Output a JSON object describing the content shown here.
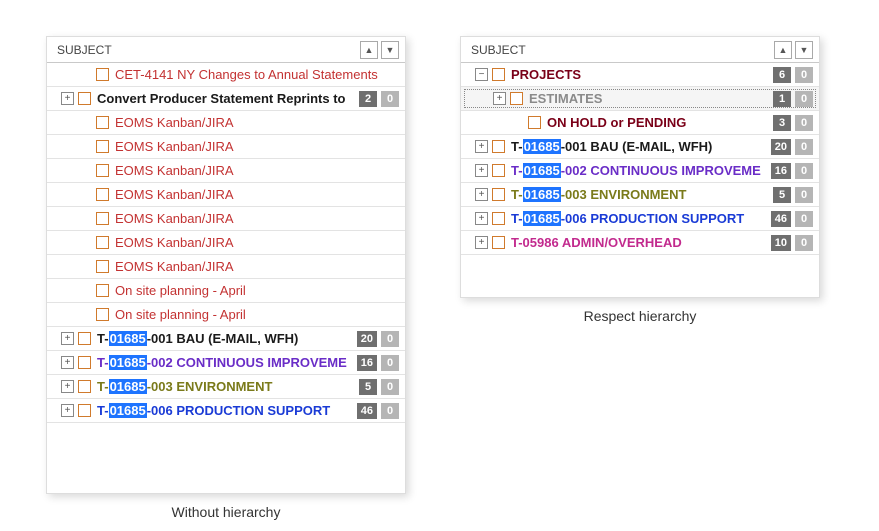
{
  "header": {
    "label": "SUBJECT"
  },
  "captions": {
    "left": "Without hierarchy",
    "right": "Respect hierarchy"
  },
  "left_rows": [
    {
      "indent": 1,
      "expander": "",
      "color": "c-red",
      "bold": false,
      "text_plain": "CET-4141  NY Changes to Annual Statements",
      "badges": []
    },
    {
      "indent": 0,
      "expander": "+",
      "color": "c-black",
      "bold": true,
      "text_plain": "Convert Producer Statement Reprints to",
      "badges": [
        2,
        0
      ]
    },
    {
      "indent": 1,
      "expander": "",
      "color": "c-red",
      "bold": false,
      "text_plain": "EOMS Kanban/JIRA",
      "badges": []
    },
    {
      "indent": 1,
      "expander": "",
      "color": "c-red",
      "bold": false,
      "text_plain": "EOMS Kanban/JIRA",
      "badges": []
    },
    {
      "indent": 1,
      "expander": "",
      "color": "c-red",
      "bold": false,
      "text_plain": "EOMS Kanban/JIRA",
      "badges": []
    },
    {
      "indent": 1,
      "expander": "",
      "color": "c-red",
      "bold": false,
      "text_plain": "EOMS Kanban/JIRA",
      "badges": []
    },
    {
      "indent": 1,
      "expander": "",
      "color": "c-red",
      "bold": false,
      "text_plain": "EOMS Kanban/JIRA",
      "badges": []
    },
    {
      "indent": 1,
      "expander": "",
      "color": "c-red",
      "bold": false,
      "text_plain": "EOMS Kanban/JIRA",
      "badges": []
    },
    {
      "indent": 1,
      "expander": "",
      "color": "c-red",
      "bold": false,
      "text_plain": "EOMS Kanban/JIRA",
      "badges": []
    },
    {
      "indent": 1,
      "expander": "",
      "color": "c-red",
      "bold": false,
      "text_plain": "On site planning - April",
      "badges": []
    },
    {
      "indent": 1,
      "expander": "",
      "color": "c-red",
      "bold": false,
      "text_plain": "On site planning - April",
      "badges": []
    },
    {
      "indent": 0,
      "expander": "+",
      "color": "c-black",
      "bold": true,
      "t_prefix": "T-",
      "t_hl": "01685",
      "t_suffix": "-001 BAU (E-MAIL, WFH)",
      "badges": [
        20,
        0
      ]
    },
    {
      "indent": 0,
      "expander": "+",
      "color": "c-purple",
      "bold": true,
      "t_prefix": "T-",
      "t_hl": "01685",
      "t_suffix": "-002 CONTINUOUS IMPROVEME",
      "badges": [
        16,
        0
      ]
    },
    {
      "indent": 0,
      "expander": "+",
      "color": "c-olive",
      "bold": true,
      "t_prefix": "T-",
      "t_hl": "01685",
      "t_suffix": "-003 ENVIRONMENT",
      "badges": [
        5,
        0
      ]
    },
    {
      "indent": 0,
      "expander": "+",
      "color": "c-blue",
      "bold": true,
      "t_prefix": "T-",
      "t_hl": "01685",
      "t_suffix": "-006 PRODUCTION SUPPORT",
      "badges": [
        46,
        0
      ]
    }
  ],
  "right_rows": [
    {
      "indent": 0,
      "expander": "-",
      "color": "c-darkred",
      "bold": true,
      "text_plain": "PROJECTS",
      "badges": [
        6,
        0
      ]
    },
    {
      "indent": 1,
      "expander": "+",
      "color": "c-gray",
      "bold": true,
      "text_plain": "ESTIMATES",
      "badges": [
        1,
        0
      ],
      "selected": true
    },
    {
      "indent": 2,
      "expander": "",
      "color": "c-darkred",
      "bold": true,
      "text_plain": "ON HOLD or PENDING",
      "badges": [
        3,
        0
      ]
    },
    {
      "indent": 0,
      "expander": "+",
      "color": "c-black",
      "bold": true,
      "t_prefix": "T-",
      "t_hl": "01685",
      "t_suffix": "-001 BAU (E-MAIL, WFH)",
      "badges": [
        20,
        0
      ]
    },
    {
      "indent": 0,
      "expander": "+",
      "color": "c-purple",
      "bold": true,
      "t_prefix": "T-",
      "t_hl": "01685",
      "t_suffix": "-002 CONTINUOUS IMPROVEME",
      "badges": [
        16,
        0
      ]
    },
    {
      "indent": 0,
      "expander": "+",
      "color": "c-olive",
      "bold": true,
      "t_prefix": "T-",
      "t_hl": "01685",
      "t_suffix": "-003 ENVIRONMENT",
      "badges": [
        5,
        0
      ]
    },
    {
      "indent": 0,
      "expander": "+",
      "color": "c-blue",
      "bold": true,
      "t_prefix": "T-",
      "t_hl": "01685",
      "t_suffix": "-006 PRODUCTION SUPPORT",
      "badges": [
        46,
        0
      ]
    },
    {
      "indent": 0,
      "expander": "+",
      "color": "c-magenta",
      "bold": true,
      "text_plain": "T-05986 ADMIN/OVERHEAD",
      "badges": [
        10,
        0
      ]
    }
  ]
}
